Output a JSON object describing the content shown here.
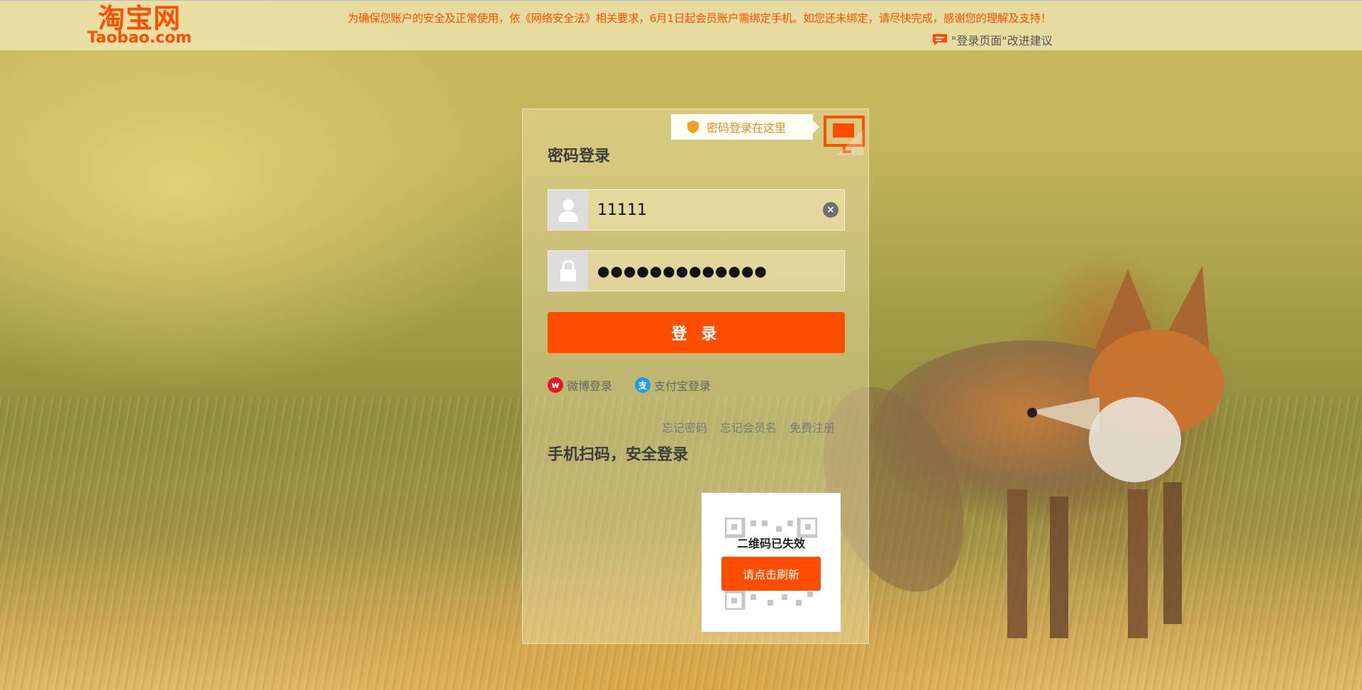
{
  "brand": {
    "logo_cn": "淘宝网",
    "logo_en": "Taobao.com",
    "color": "#ff4e00"
  },
  "header": {
    "notice": "为确保您账户的安全及正常使用，依《网络安全法》相关要求，6月1日起会员账户需绑定手机。如您还未绑定，请尽快完成，感谢您的理解及支持！",
    "feedback_label": "\"登录页面\"改进建议",
    "feedback_icon": "chat-bubble-icon"
  },
  "login": {
    "tip_text": "密码登录在这里",
    "tip_icon": "shield-icon",
    "qr_switch_icon": "qr-monitor-icon",
    "title": "密码登录",
    "username": {
      "icon": "user-icon",
      "value": "11111"
    },
    "password": {
      "icon": "lock-icon",
      "value": "●●●●●●●●●●●●●"
    },
    "submit_label": "登 录",
    "third_party": [
      {
        "label": "微博登录",
        "icon": "weibo-icon",
        "color": "#e6162d"
      },
      {
        "label": "支付宝登录",
        "icon": "alipay-icon",
        "color": "#1b9ee8"
      }
    ],
    "links": [
      "忘记密码",
      "忘记会员名",
      "免费注册"
    ]
  },
  "qr": {
    "title": "手机扫码，安全登录",
    "expired_text": "二维码已失效",
    "refresh_label": "请点击刷新"
  }
}
